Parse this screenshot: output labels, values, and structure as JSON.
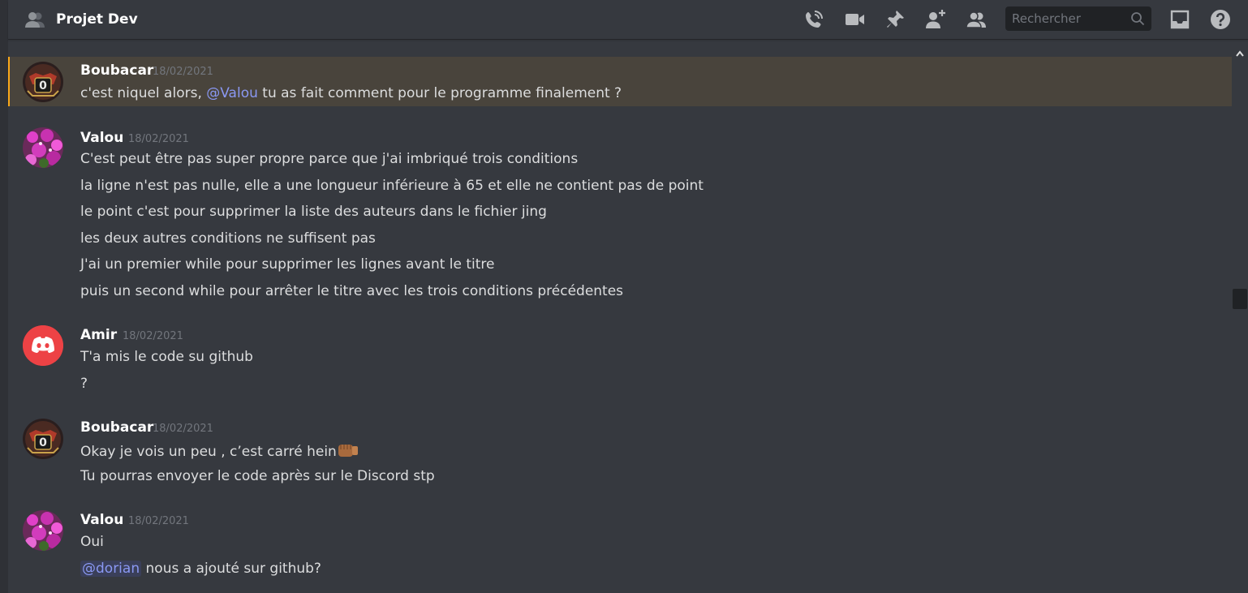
{
  "header": {
    "channel_title": "Projet Dev",
    "search_placeholder": "Rechercher",
    "icons": [
      "members-channel-icon",
      "call-icon",
      "video-icon",
      "pin-icon",
      "add-friend-icon",
      "member-list-icon",
      "search-icon",
      "inbox-icon",
      "help-icon"
    ]
  },
  "messages": [
    {
      "username": "Boubacar",
      "timestamp": "18/02/2021",
      "highlighted": true,
      "line1_pre": "c'est niquel alors, ",
      "line1_mention": "@Valou",
      "line1_post": " tu as fait comment pour le programme finalement ?"
    },
    {
      "username": "Valou",
      "timestamp": "18/02/2021",
      "lines": [
        "C'est peut être pas super propre parce que j'ai imbriqué trois conditions",
        "la ligne n'est pas nulle, elle a une longueur inférieure à 65 et elle ne contient pas de point",
        "le point c'est pour supprimer la liste des auteurs dans le fichier jing",
        "les deux autres conditions ne suffisent pas",
        "J'ai un premier while pour supprimer les lignes avant le titre",
        "puis un second while pour arrêter le titre avec les trois conditions précédentes"
      ]
    },
    {
      "username": "Amir",
      "timestamp": "18/02/2021",
      "lines": [
        "T'a mis le code su github",
        "?"
      ]
    },
    {
      "username": "Boubacar",
      "timestamp": "18/02/2021",
      "lines": [
        "Okay je vois un peu , c’est carré hein",
        "Tu pourras envoyer le code après sur le Discord stp"
      ],
      "emoji": "fist-bump-emoji"
    },
    {
      "username": "Valou",
      "timestamp": "18/02/2021",
      "line1": "Oui",
      "line2_mention": "@dorian",
      "line2_post": " nous a ajouté sur github?"
    }
  ],
  "colors": {
    "background": "#36393f",
    "mention": "#8a98f3",
    "highlight_bar": "#faa81a",
    "amir_avatar": "#ed4245"
  }
}
